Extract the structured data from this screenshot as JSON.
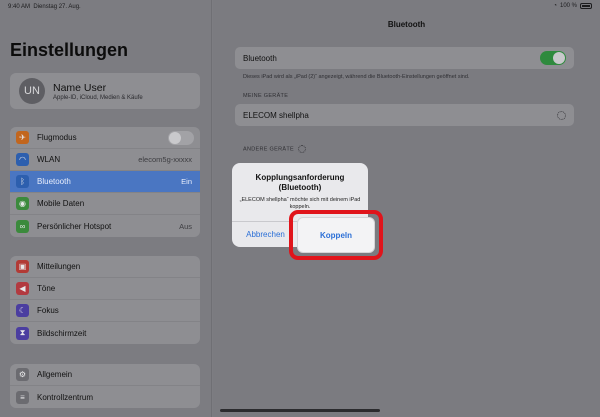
{
  "status": {
    "time": "9:40 AM",
    "date": "Dienstag 27. Aug.",
    "battery": "100 %"
  },
  "sidebar": {
    "title": "Einstellungen",
    "profile": {
      "initials": "UN",
      "name": "Name User",
      "subtitle": "Apple-ID, iCloud, Medien & Käufe"
    },
    "groups": [
      [
        {
          "label": "Flugmodus",
          "icon": "airplane-icon",
          "color": "#c2661e",
          "value": ""
        },
        {
          "label": "WLAN",
          "icon": "wifi-icon",
          "color": "#2d5fae",
          "value": "elecom5g-xxxxx"
        },
        {
          "label": "Bluetooth",
          "icon": "bluetooth-icon",
          "color": "#2d5fae",
          "value": "Ein"
        },
        {
          "label": "Mobile Daten",
          "icon": "antenna-icon",
          "color": "#3b8a3c",
          "value": ""
        },
        {
          "label": "Persönlicher Hotspot",
          "icon": "hotspot-icon",
          "color": "#3b8a3c",
          "value": "Aus"
        }
      ],
      [
        {
          "label": "Mitteilungen",
          "icon": "notifications-icon",
          "color": "#b23a35"
        },
        {
          "label": "Töne",
          "icon": "speaker-icon",
          "color": "#b23a40"
        },
        {
          "label": "Fokus",
          "icon": "moon-icon",
          "color": "#4b3ea0"
        },
        {
          "label": "Bildschirmzeit",
          "icon": "hourglass-icon",
          "color": "#4b3ea0"
        }
      ],
      [
        {
          "label": "Allgemein",
          "icon": "gear-icon",
          "color": "#6b6b70"
        },
        {
          "label": "Kontrollzentrum",
          "icon": "control-center-icon",
          "color": "#6b6b70"
        }
      ]
    ]
  },
  "detail": {
    "title": "Bluetooth",
    "bluetooth_label": "Bluetooth",
    "note": "Dieses iPad wird als „iPad (2)“ angezeigt, während die Bluetooth-Einstellungen geöffnet sind.",
    "my_devices_header": "MEINE GERÄTE",
    "device_name": "ELECOM shellpha",
    "other_devices_header": "ANDERE GERÄTE"
  },
  "alert": {
    "title": "Kopplungsanforderung (Bluetooth)",
    "message": "„ELECOM shellpha“ möchte sich mit deinem iPad koppeln.",
    "cancel": "Abbrechen",
    "confirm": "Koppeln"
  },
  "colors": {
    "toggle_on": "#2f8a3e",
    "highlight": "#e0141b",
    "link": "#2b6fd6"
  }
}
